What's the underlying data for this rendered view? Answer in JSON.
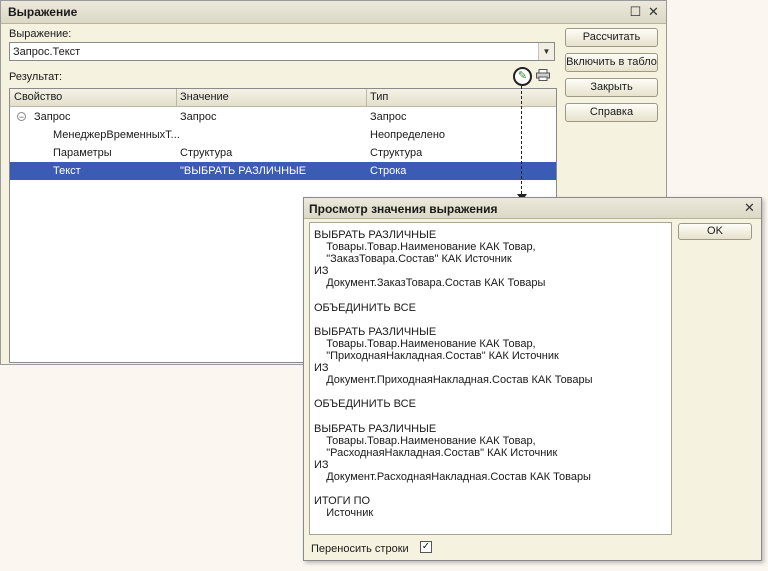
{
  "main_window": {
    "title": "Выражение",
    "expression_label": "Выражение:",
    "expression_value": "Запрос.Текст",
    "result_label": "Результат:",
    "buttons": {
      "calculate": "Рассчитать",
      "include_in_table": "Включить в табло",
      "close": "Закрыть",
      "help": "Справка"
    },
    "grid": {
      "columns": [
        "Свойство",
        "Значение",
        "Тип"
      ],
      "rows": [
        {
          "property": "Запрос",
          "value": "Запрос",
          "type": "Запрос"
        },
        {
          "property": "МенеджерВременныхТ...",
          "value": "",
          "type": "Неопределено"
        },
        {
          "property": "Параметры",
          "value": "Структура",
          "type": "Структура"
        },
        {
          "property": "Текст",
          "value": "\"ВЫБРАТЬ РАЗЛИЧНЫЕ",
          "type": "Строка"
        }
      ]
    }
  },
  "view_window": {
    "title": "Просмотр значения выражения",
    "ok_label": "OK",
    "wrap_label": "Переносить строки",
    "wrap_checked": true,
    "text_lines": [
      "ВЫБРАТЬ РАЗЛИЧНЫЕ",
      "    Товары.Товар.Наименование КАК Товар,",
      "    \"ЗаказТовара.Состав\" КАК Источник",
      "ИЗ",
      "    Документ.ЗаказТовара.Состав КАК Товары",
      "",
      "ОБЪЕДИНИТЬ ВСЕ",
      "",
      "ВЫБРАТЬ РАЗЛИЧНЫЕ",
      "    Товары.Товар.Наименование КАК Товар,",
      "    \"ПриходнаяНакладная.Состав\" КАК Источник",
      "ИЗ",
      "    Документ.ПриходнаяНакладная.Состав КАК Товары",
      "",
      "ОБЪЕДИНИТЬ ВСЕ",
      "",
      "ВЫБРАТЬ РАЗЛИЧНЫЕ",
      "    Товары.Товар.Наименование КАК Товар,",
      "    \"РасходнаяНакладная.Состав\" КАК Источник",
      "ИЗ",
      "    Документ.РасходнаяНакладная.Состав КАК Товары",
      "",
      "ИТОГИ ПО",
      "    Источник"
    ]
  }
}
